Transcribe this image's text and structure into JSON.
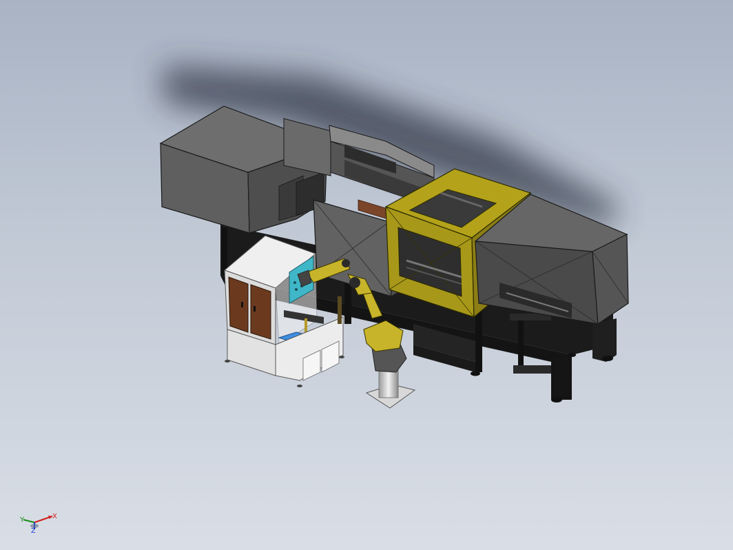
{
  "viewport": {
    "background_top": "#a9b3c4",
    "background_bottom": "#d9dee6"
  },
  "model": {
    "colors": {
      "machine_gray": "#5f5f5f",
      "machine_dark": "#3c3c3c",
      "frame_black": "#1b1b1b",
      "mold_yellow": "#b3a21a",
      "robot_yellow": "#c8b42a",
      "cabinet_white": "#e4e4e4",
      "cabinet_door_brown": "#6b3a1e",
      "tray_blue": "#3d8fe0",
      "panel_cyan": "#3fb7c8"
    }
  },
  "triad": {
    "x_label": "X",
    "y_label": "Y",
    "z_label": "Z",
    "x_color": "#d21e1e",
    "y_color": "#1a8a1a",
    "z_color": "#1e3cd2"
  }
}
